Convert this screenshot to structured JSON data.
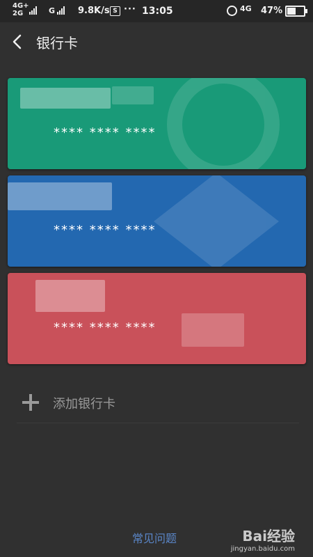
{
  "status_bar": {
    "network_top": "4G+",
    "network_bottom": "2G",
    "network_g": "G",
    "speed": "9.8K/s",
    "s_icon": "S",
    "dots": "···",
    "time": "13:05",
    "network_right": "4G",
    "battery": "47%",
    "battery_level": 0.47
  },
  "header": {
    "title": "银行卡"
  },
  "cards": [
    {
      "number": "**** **** ****",
      "color": "#199a78"
    },
    {
      "number": "**** **** ****",
      "color": "#2368b0"
    },
    {
      "number": "**** **** ****",
      "color": "#c9515a"
    }
  ],
  "add_card": {
    "label": "添加银行卡",
    "icon": "plus-icon"
  },
  "footer": {
    "faq_link": "常见问题"
  },
  "watermark": {
    "logo": "Bai经验",
    "url": "jingyan.baidu.com"
  }
}
